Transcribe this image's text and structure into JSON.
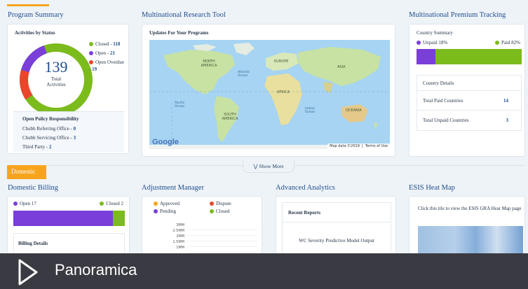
{
  "colors": {
    "orange": "#f7a41d",
    "green": "#7cbb1c",
    "purple": "#7a3ed9",
    "red": "#e8472c",
    "blue": "#1f4e8c",
    "footer_bg": "#3a3a42"
  },
  "program_summary": {
    "title": "Program Summary",
    "card_title": "Activities by Status",
    "donut_total": "139",
    "donut_label_1": "Total",
    "donut_label_2": "Activities",
    "legend": [
      {
        "label": "Closed -",
        "value": "118",
        "color": "#7cbb1c"
      },
      {
        "label": "Open -",
        "value": "21",
        "color": "#7a3ed9"
      },
      {
        "label": "Open Overdue -",
        "value": "19",
        "color": "#e8472c"
      }
    ],
    "policy": {
      "title": "Open Policy Responsibility",
      "rows": [
        {
          "label": "Chubb Referring Office -",
          "value": "0"
        },
        {
          "label": "Chubb Servicing Office -",
          "value": "3"
        },
        {
          "label": "Third Party -",
          "value": "2"
        }
      ]
    }
  },
  "research_tool": {
    "title": "Multinational Research Tool",
    "card_title": "Updates For Your Programs",
    "map_labels": {
      "north_america": "NORTH AMERICA",
      "south_america": "SOUTH AMERICA",
      "europe": "EUROPE",
      "africa": "AFRICA",
      "asia": "ASIA",
      "oceania": "OCEANIA",
      "atlantic": "Atlantic Ocean",
      "pacific": "Pacific Ocean",
      "indian": "Indian Ocean"
    },
    "google_logo": "Google",
    "map_data": "Map data ©2019",
    "terms": "Terms of Use"
  },
  "premium_tracking": {
    "title": "Multinational Premium Tracking",
    "summary_title": "Country Summary",
    "unpaid_label": "Unpaid 18%",
    "paid_label": "Paid 82%",
    "unpaid_fraction": 0.18,
    "details_title": "Country Details",
    "rows": [
      {
        "label": "Total Paid Countries",
        "value": "14"
      },
      {
        "label": "Total Unpaid Countries",
        "value": "3"
      }
    ]
  },
  "show_more": "Show More",
  "domestic": {
    "tab": "Domestic",
    "billing": {
      "title": "Domestic Billing",
      "open_label": "Open 17",
      "closed_label": "Closed 2",
      "open_fraction": 0.89,
      "details_title": "Billing Details"
    },
    "adjustment": {
      "title": "Adjustment Manager",
      "legend": [
        {
          "label": "Approved",
          "color": "#f7a41d"
        },
        {
          "label": "Dispute",
          "color": "#e8472c"
        },
        {
          "label": "Pending",
          "color": "#7a3ed9"
        },
        {
          "label": "Closed",
          "color": "#7cbb1c"
        }
      ],
      "ticks": [
        "3MM",
        "2.5MM",
        "2MM",
        "1.5MM",
        "1MM"
      ]
    },
    "analytics": {
      "title": "Advanced Analytics",
      "card_title": "Recent Reports",
      "report": "WC Severity Predictive Model Output"
    },
    "heatmap": {
      "title": "ESIS Heat Map",
      "text": "Click this tile to view the ESIS GRA Heat Map page"
    }
  },
  "footer": {
    "brand": "Panoramica"
  }
}
